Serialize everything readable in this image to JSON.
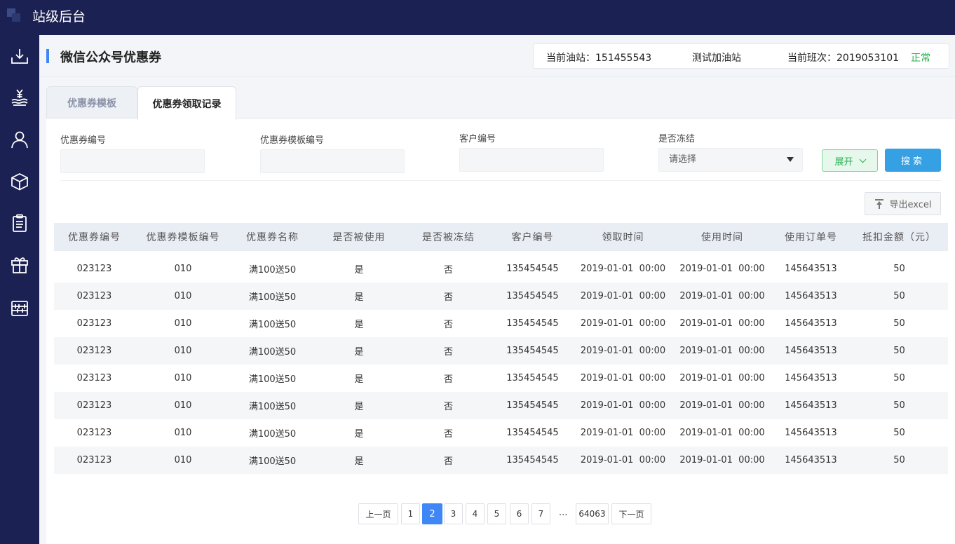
{
  "app": {
    "title": "站级后台"
  },
  "sidebar": {
    "items": [
      {
        "icon": "download-tray-icon"
      },
      {
        "icon": "yuan-coin-hand-icon"
      },
      {
        "icon": "user-icon"
      },
      {
        "icon": "cube-icon"
      },
      {
        "icon": "clipboard-icon"
      },
      {
        "icon": "gift-icon"
      },
      {
        "icon": "abacus-icon"
      }
    ]
  },
  "header": {
    "page_title": "微信公众号优惠券",
    "station_label": "当前油站：151455543",
    "station_name": "测试加油站",
    "shift_label": "当前班次：2019053101",
    "status": "正常"
  },
  "colors": {
    "accent": "#3f86f7",
    "sidebar_bg": "#1c2153",
    "status_green": "#23b14d",
    "search_button": "#35a0e4"
  },
  "tabs": [
    {
      "label": "优惠券模板",
      "active": false
    },
    {
      "label": "优惠券领取记录",
      "active": true
    }
  ],
  "filters": {
    "coupon_no": {
      "label": "优惠券编号",
      "value": ""
    },
    "template_no": {
      "label": "优惠券模板编号",
      "value": ""
    },
    "customer_no": {
      "label": "客户编号",
      "value": ""
    },
    "frozen": {
      "label": "是否冻结",
      "selected": "请选择"
    },
    "expand_label": "展开",
    "search_label": "搜索"
  },
  "export": {
    "label": "导出excel"
  },
  "table": {
    "columns": [
      "优惠券编号",
      "优惠券模板编号",
      "优惠券名称",
      "是否被使用",
      "是否被冻结",
      "客户编号",
      "领取时间",
      "使用时间",
      "使用订单号",
      "抵扣金额（元）"
    ],
    "rows": [
      [
        "023123",
        "010",
        "满100送50",
        "是",
        "否",
        "135454545",
        "2019-01-01  00:00",
        "2019-01-01  00:00",
        "145643513",
        "50"
      ],
      [
        "023123",
        "010",
        "满100送50",
        "是",
        "否",
        "135454545",
        "2019-01-01  00:00",
        "2019-01-01  00:00",
        "145643513",
        "50"
      ],
      [
        "023123",
        "010",
        "满100送50",
        "是",
        "否",
        "135454545",
        "2019-01-01  00:00",
        "2019-01-01  00:00",
        "145643513",
        "50"
      ],
      [
        "023123",
        "010",
        "满100送50",
        "是",
        "否",
        "135454545",
        "2019-01-01  00:00",
        "2019-01-01  00:00",
        "145643513",
        "50"
      ],
      [
        "023123",
        "010",
        "满100送50",
        "是",
        "否",
        "135454545",
        "2019-01-01  00:00",
        "2019-01-01  00:00",
        "145643513",
        "50"
      ],
      [
        "023123",
        "010",
        "满100送50",
        "是",
        "否",
        "135454545",
        "2019-01-01  00:00",
        "2019-01-01  00:00",
        "145643513",
        "50"
      ],
      [
        "023123",
        "010",
        "满100送50",
        "是",
        "否",
        "135454545",
        "2019-01-01  00:00",
        "2019-01-01  00:00",
        "145643513",
        "50"
      ],
      [
        "023123",
        "010",
        "满100送50",
        "是",
        "否",
        "135454545",
        "2019-01-01  00:00",
        "2019-01-01  00:00",
        "145643513",
        "50"
      ]
    ]
  },
  "pagination": {
    "prev_label": "上一页",
    "pages": [
      "1",
      "2",
      "3",
      "4",
      "5",
      "6",
      "7"
    ],
    "current": "2",
    "ellipsis": "...",
    "last_page": "64063",
    "next_label": "下一页"
  }
}
